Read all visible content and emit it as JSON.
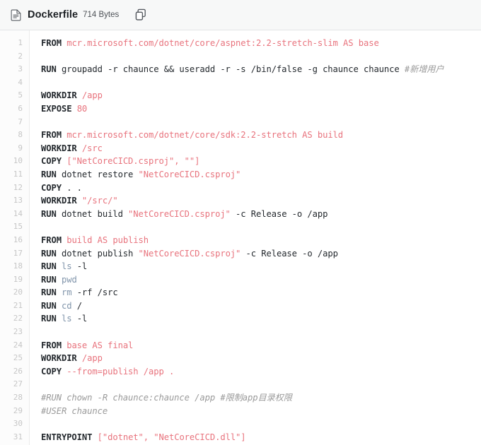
{
  "header": {
    "file_icon": "document-icon",
    "filename": "Dockerfile",
    "filesize": "714 Bytes",
    "copy_icon": "copy-icon",
    "copy_label": "Copy"
  },
  "colors": {
    "keyword": "#24292e",
    "argument": "#e8737d",
    "string": "#e8737d",
    "command": "#8195ab",
    "comment": "#9a9a9a",
    "gutter_number": "#c6c6c6",
    "header_bg": "#f7f8f8",
    "code_bg": "#ffffff"
  },
  "code": {
    "language": "dockerfile",
    "total_lines": 31,
    "lines": [
      {
        "n": "1",
        "tokens": [
          {
            "t": "FROM",
            "c": "kw"
          },
          {
            "t": " ",
            "c": "plain"
          },
          {
            "t": "mcr.microsoft.com/dotnet/core/aspnet:2.2-stretch-slim AS base",
            "c": "arg"
          }
        ]
      },
      {
        "n": "2",
        "tokens": []
      },
      {
        "n": "3",
        "tokens": [
          {
            "t": "RUN",
            "c": "kw"
          },
          {
            "t": " groupadd -r chaunce && useradd -r -s /bin/false -g chaunce chaunce ",
            "c": "plain"
          },
          {
            "t": "#新增用户",
            "c": "cmt"
          }
        ]
      },
      {
        "n": "4",
        "tokens": []
      },
      {
        "n": "5",
        "tokens": [
          {
            "t": "WORKDIR",
            "c": "kw"
          },
          {
            "t": " ",
            "c": "plain"
          },
          {
            "t": "/app",
            "c": "arg"
          }
        ]
      },
      {
        "n": "6",
        "tokens": [
          {
            "t": "EXPOSE",
            "c": "kw"
          },
          {
            "t": " ",
            "c": "plain"
          },
          {
            "t": "80",
            "c": "arg"
          }
        ]
      },
      {
        "n": "7",
        "tokens": []
      },
      {
        "n": "8",
        "tokens": [
          {
            "t": "FROM",
            "c": "kw"
          },
          {
            "t": " ",
            "c": "plain"
          },
          {
            "t": "mcr.microsoft.com/dotnet/core/sdk:2.2-stretch AS build",
            "c": "arg"
          }
        ]
      },
      {
        "n": "9",
        "tokens": [
          {
            "t": "WORKDIR",
            "c": "kw"
          },
          {
            "t": " ",
            "c": "plain"
          },
          {
            "t": "/src",
            "c": "arg"
          }
        ]
      },
      {
        "n": "10",
        "tokens": [
          {
            "t": "COPY",
            "c": "kw"
          },
          {
            "t": " ",
            "c": "plain"
          },
          {
            "t": "[\"NetCoreCICD.csproj\", \"\"]",
            "c": "str"
          }
        ]
      },
      {
        "n": "11",
        "tokens": [
          {
            "t": "RUN",
            "c": "kw"
          },
          {
            "t": " dotnet restore ",
            "c": "plain"
          },
          {
            "t": "\"NetCoreCICD.csproj\"",
            "c": "str"
          }
        ]
      },
      {
        "n": "12",
        "tokens": [
          {
            "t": "COPY",
            "c": "kw"
          },
          {
            "t": " . .",
            "c": "plain"
          }
        ]
      },
      {
        "n": "13",
        "tokens": [
          {
            "t": "WORKDIR",
            "c": "kw"
          },
          {
            "t": " ",
            "c": "plain"
          },
          {
            "t": "\"/src/\"",
            "c": "str"
          }
        ]
      },
      {
        "n": "14",
        "tokens": [
          {
            "t": "RUN",
            "c": "kw"
          },
          {
            "t": " dotnet build ",
            "c": "plain"
          },
          {
            "t": "\"NetCoreCICD.csproj\"",
            "c": "str"
          },
          {
            "t": " -c Release -o /app",
            "c": "plain"
          }
        ]
      },
      {
        "n": "15",
        "tokens": []
      },
      {
        "n": "16",
        "tokens": [
          {
            "t": "FROM",
            "c": "kw"
          },
          {
            "t": " ",
            "c": "plain"
          },
          {
            "t": "build AS publish",
            "c": "arg"
          }
        ]
      },
      {
        "n": "17",
        "tokens": [
          {
            "t": "RUN",
            "c": "kw"
          },
          {
            "t": " dotnet publish ",
            "c": "plain"
          },
          {
            "t": "\"NetCoreCICD.csproj\"",
            "c": "str"
          },
          {
            "t": " -c Release -o /app",
            "c": "plain"
          }
        ]
      },
      {
        "n": "18",
        "tokens": [
          {
            "t": "RUN",
            "c": "kw"
          },
          {
            "t": " ",
            "c": "plain"
          },
          {
            "t": "ls",
            "c": "cmd"
          },
          {
            "t": " -l",
            "c": "plain"
          }
        ]
      },
      {
        "n": "19",
        "tokens": [
          {
            "t": "RUN",
            "c": "kw"
          },
          {
            "t": " ",
            "c": "plain"
          },
          {
            "t": "pwd",
            "c": "cmd"
          }
        ]
      },
      {
        "n": "20",
        "tokens": [
          {
            "t": "RUN",
            "c": "kw"
          },
          {
            "t": " ",
            "c": "plain"
          },
          {
            "t": "rm",
            "c": "cmd"
          },
          {
            "t": " -rf /src",
            "c": "plain"
          }
        ]
      },
      {
        "n": "21",
        "tokens": [
          {
            "t": "RUN",
            "c": "kw"
          },
          {
            "t": " ",
            "c": "plain"
          },
          {
            "t": "cd",
            "c": "cmd"
          },
          {
            "t": " /",
            "c": "plain"
          }
        ]
      },
      {
        "n": "22",
        "tokens": [
          {
            "t": "RUN",
            "c": "kw"
          },
          {
            "t": " ",
            "c": "plain"
          },
          {
            "t": "ls",
            "c": "cmd"
          },
          {
            "t": " -l",
            "c": "plain"
          }
        ]
      },
      {
        "n": "23",
        "tokens": []
      },
      {
        "n": "24",
        "tokens": [
          {
            "t": "FROM",
            "c": "kw"
          },
          {
            "t": " ",
            "c": "plain"
          },
          {
            "t": "base AS final",
            "c": "arg"
          }
        ]
      },
      {
        "n": "25",
        "tokens": [
          {
            "t": "WORKDIR",
            "c": "kw"
          },
          {
            "t": " ",
            "c": "plain"
          },
          {
            "t": "/app",
            "c": "arg"
          }
        ]
      },
      {
        "n": "26",
        "tokens": [
          {
            "t": "COPY",
            "c": "kw"
          },
          {
            "t": " ",
            "c": "plain"
          },
          {
            "t": "--from=publish /app .",
            "c": "arg"
          }
        ]
      },
      {
        "n": "27",
        "tokens": []
      },
      {
        "n": "28",
        "tokens": [
          {
            "t": "#RUN chown -R chaunce:chaunce /app #限制app目录权限",
            "c": "cmt"
          }
        ]
      },
      {
        "n": "29",
        "tokens": [
          {
            "t": "#USER chaunce",
            "c": "cmt"
          }
        ]
      },
      {
        "n": "30",
        "tokens": []
      },
      {
        "n": "31",
        "tokens": [
          {
            "t": "ENTRYPOINT",
            "c": "kw"
          },
          {
            "t": " ",
            "c": "plain"
          },
          {
            "t": "[\"dotnet\", \"NetCoreCICD.dll\"]",
            "c": "str"
          }
        ]
      }
    ]
  }
}
